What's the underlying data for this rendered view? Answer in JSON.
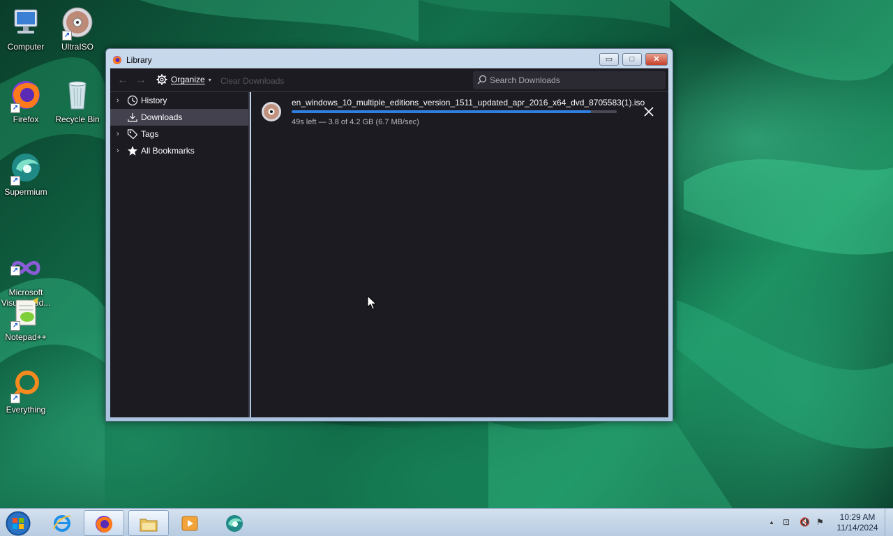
{
  "desktop": {
    "icons": [
      {
        "label": "Computer",
        "icon": "computer-icon"
      },
      {
        "label": "UltraISO",
        "icon": "disc-icon"
      },
      {
        "label": "Firefox",
        "icon": "firefox-icon"
      },
      {
        "label": "Recycle Bin",
        "icon": "recycle-bin-icon"
      },
      {
        "label": "Supermium",
        "icon": "supermium-icon"
      },
      {
        "label": "Microsoft\nVisual Stud...",
        "icon": "visual-studio-icon"
      },
      {
        "label": "Notepad++",
        "icon": "notepadpp-icon"
      },
      {
        "label": "Everything",
        "icon": "everything-icon"
      }
    ]
  },
  "window": {
    "title": "Library",
    "controls": {
      "minimize": "▭",
      "maximize": "□",
      "close": "✕"
    }
  },
  "toolbar": {
    "back": "←",
    "forward": "→",
    "organize_label": "Organize",
    "organize_caret": "▾",
    "clear_downloads": "Clear Downloads",
    "search_placeholder": "Search Downloads"
  },
  "sidebar": {
    "items": [
      {
        "label": "History",
        "icon": "clock-icon",
        "twisty": "›",
        "selected": false
      },
      {
        "label": "Downloads",
        "icon": "download-icon",
        "twisty": "",
        "selected": true
      },
      {
        "label": "Tags",
        "icon": "tag-icon",
        "twisty": "›",
        "selected": false
      },
      {
        "label": "All Bookmarks",
        "icon": "star-icon",
        "twisty": "›",
        "selected": false
      }
    ]
  },
  "downloads": [
    {
      "filename": "en_windows_10_multiple_editions_version_1511_updated_apr_2016_x64_dvd_8705583(1).iso",
      "status": "49s left — 3.8 of 4.2 GB (6.7 MB/sec)",
      "progress": 0.92,
      "icon": "disc-icon"
    }
  ],
  "taskbar": {
    "buttons": [
      {
        "name": "start-button",
        "icon": "windows-orb-icon"
      },
      {
        "name": "internet-explorer",
        "icon": "ie-icon"
      },
      {
        "name": "firefox",
        "icon": "firefox-icon",
        "active": true
      },
      {
        "name": "file-explorer",
        "icon": "folder-icon"
      },
      {
        "name": "media-player",
        "icon": "media-player-icon"
      },
      {
        "name": "supermium",
        "icon": "supermium-icon"
      }
    ],
    "tray": {
      "expand": "▲",
      "network": "⊡",
      "volume": "🔇",
      "flag": "⚑"
    },
    "clock": {
      "time": "10:29 AM",
      "date": "11/14/2024"
    }
  },
  "colors": {
    "accent": "#2f7fe0",
    "window_bg": "#1c1b22",
    "selected_bg": "#42414d"
  }
}
